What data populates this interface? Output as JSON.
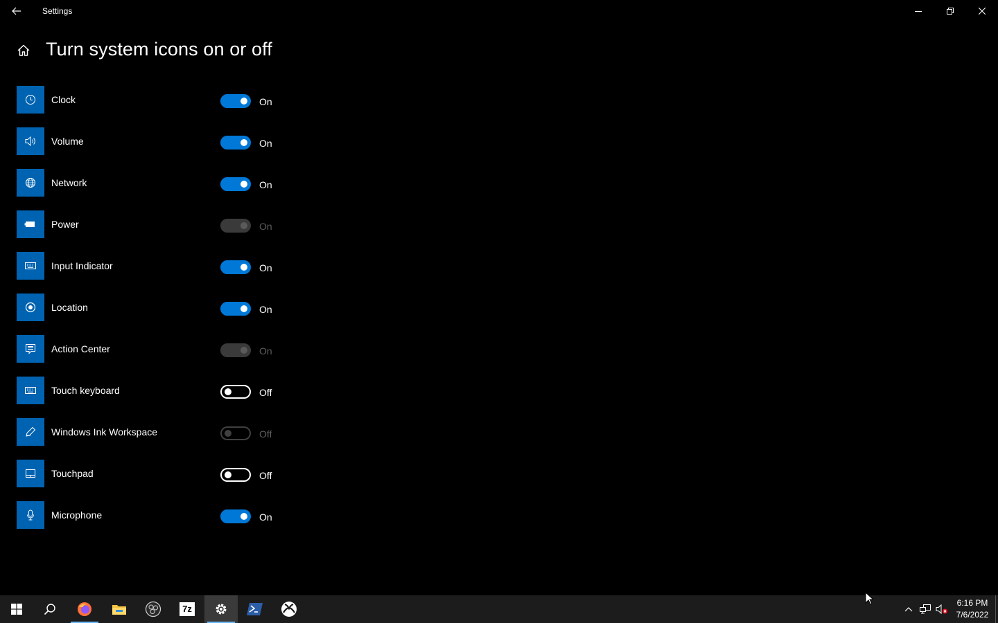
{
  "window": {
    "title": "Settings"
  },
  "page": {
    "title": "Turn system icons on or off"
  },
  "items": [
    {
      "label": "Clock",
      "state": "On",
      "on": true,
      "disabled": false,
      "icon": "clock-icon"
    },
    {
      "label": "Volume",
      "state": "On",
      "on": true,
      "disabled": false,
      "icon": "volume-icon"
    },
    {
      "label": "Network",
      "state": "On",
      "on": true,
      "disabled": false,
      "icon": "globe-icon"
    },
    {
      "label": "Power",
      "state": "On",
      "on": true,
      "disabled": true,
      "icon": "battery-icon"
    },
    {
      "label": "Input Indicator",
      "state": "On",
      "on": true,
      "disabled": false,
      "icon": "keyboard-icon"
    },
    {
      "label": "Location",
      "state": "On",
      "on": true,
      "disabled": false,
      "icon": "location-icon"
    },
    {
      "label": "Action Center",
      "state": "On",
      "on": true,
      "disabled": true,
      "icon": "action-center-icon"
    },
    {
      "label": "Touch keyboard",
      "state": "Off",
      "on": false,
      "disabled": false,
      "icon": "touch-keyboard-icon"
    },
    {
      "label": "Windows Ink Workspace",
      "state": "Off",
      "on": false,
      "disabled": true,
      "icon": "pen-icon"
    },
    {
      "label": "Touchpad",
      "state": "Off",
      "on": false,
      "disabled": false,
      "icon": "touchpad-icon"
    },
    {
      "label": "Microphone",
      "state": "On",
      "on": true,
      "disabled": false,
      "icon": "microphone-icon"
    }
  ],
  "taskbar": {
    "apps": [
      "start-icon",
      "search-icon",
      "firefox-icon",
      "file-explorer-icon",
      "obs-icon",
      "7zip-icon",
      "settings-gear-icon",
      "powershell-icon",
      "xbox-icon"
    ],
    "seven_zip_label": "7z",
    "clock": {
      "time": "6:16 PM",
      "date": "7/6/2022"
    }
  },
  "colors": {
    "accent": "#0078d7",
    "icon_tile": "#0063b1",
    "background": "#000000",
    "taskbar": "#1c1c1c"
  }
}
